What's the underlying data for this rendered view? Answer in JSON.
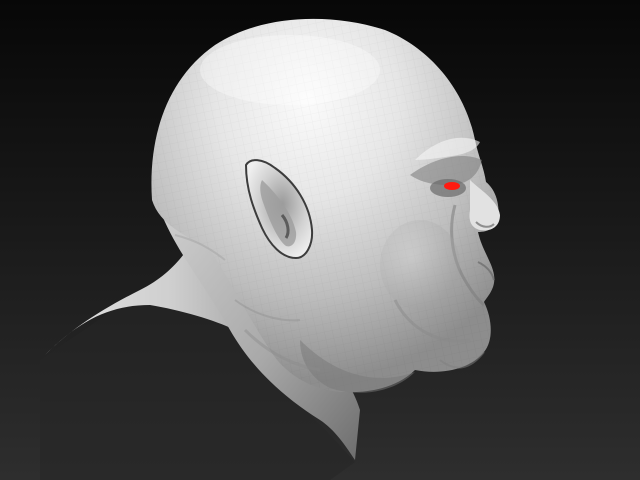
{
  "viewport": {
    "background_top": "#070707",
    "background_bottom": "#2e2e2e"
  },
  "model": {
    "subject": "sculpted-head",
    "material_light": "#f2f2f2",
    "material_mid": "#b8b8b8",
    "material_shadow": "#5e5e5e",
    "material_deep": "#2a2a2a",
    "eye_color": "#ff1a10"
  }
}
